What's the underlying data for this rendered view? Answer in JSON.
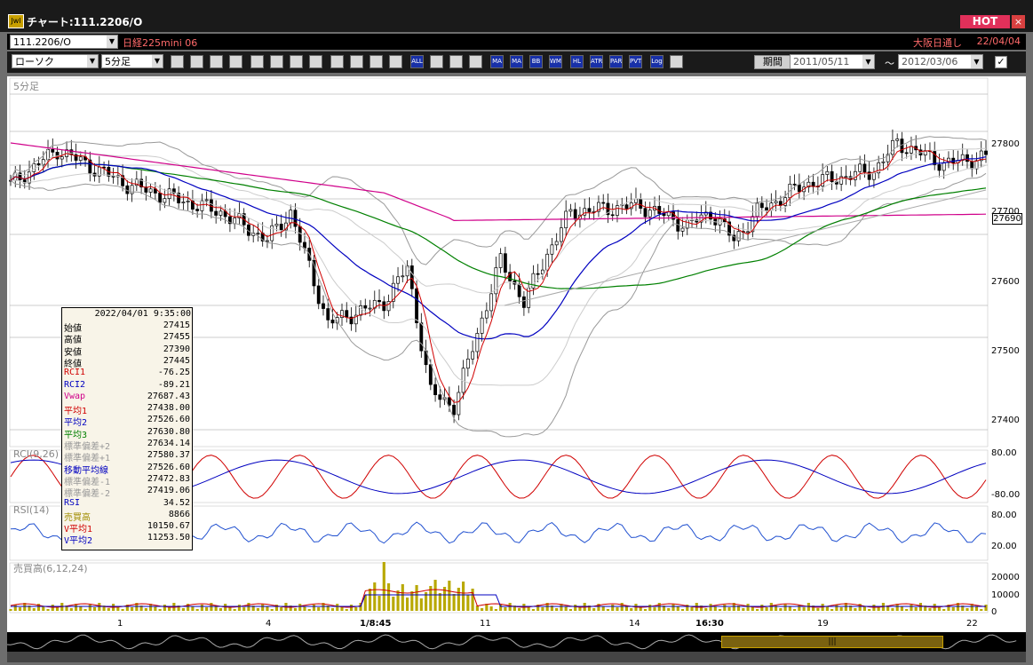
{
  "window": {
    "title": "チャート:111.2206/O",
    "hot": "HOT",
    "close": "×",
    "app_icon": "Jwl"
  },
  "toolbar1": {
    "symbol": "111.2206/O",
    "name": "日経225mini 06",
    "market": "大阪日通し",
    "date": "22/04/04"
  },
  "toolbar2": {
    "chart_type": "ローソク",
    "timeframe": "5分足",
    "tools": [
      "magnifier-icon",
      "crosshair-icon",
      "zoom-icon",
      "search-icon",
      "grid-icon",
      "candle-icon",
      "alert-icon",
      "pen-icon",
      "cursor-icon",
      "undo-icon",
      "box-icon",
      "box2-icon",
      "ALL",
      "fibo-icon",
      "brush-icon",
      "color-icon",
      "MA",
      "MA",
      "BB",
      "WMA",
      "HL",
      "ATR",
      "PARA",
      "PVT",
      "Log",
      "window-icon"
    ],
    "period_label": "期間",
    "date_from": "2011/05/11",
    "tilde": "～",
    "date_to": "2012/03/06",
    "check": "✓"
  },
  "panels": {
    "price": "5分足",
    "rci": "RCI(9,26)",
    "rsi": "RSI(14)",
    "volume": "売買高(6,12,24)"
  },
  "price_axis": [
    "27800",
    "27700",
    "27600",
    "27500",
    "27400"
  ],
  "current_price": "27690",
  "rci_axis": [
    "80.00",
    "-80.00"
  ],
  "rsi_axis": [
    "80.00",
    "20.00"
  ],
  "vol_axis": [
    "20000",
    "10000",
    "0"
  ],
  "x_axis": [
    {
      "label": "1",
      "pos": 132,
      "bold": false
    },
    {
      "label": "4",
      "pos": 299,
      "bold": false
    },
    {
      "label": "1/8:45",
      "pos": 405,
      "bold": true
    },
    {
      "label": "11",
      "pos": 540,
      "bold": false
    },
    {
      "label": "14",
      "pos": 708,
      "bold": false
    },
    {
      "label": "16:30",
      "pos": 783,
      "bold": true
    },
    {
      "label": "19",
      "pos": 920,
      "bold": false
    },
    {
      "label": "22",
      "pos": 1088,
      "bold": false
    }
  ],
  "databox": {
    "datetime": "2022/04/01 9:35:00",
    "rows": [
      {
        "k": "始値",
        "v": "27415",
        "c": "#000000"
      },
      {
        "k": "高値",
        "v": "27455",
        "c": "#000000"
      },
      {
        "k": "安値",
        "v": "27390",
        "c": "#000000"
      },
      {
        "k": "終値",
        "v": "27445",
        "c": "#000000"
      },
      {
        "k": "RCI1",
        "v": "-76.25",
        "c": "#d00000"
      },
      {
        "k": "RCI2",
        "v": "-89.21",
        "c": "#0000c0"
      },
      {
        "k": "Vwap",
        "v": "27687.43",
        "c": "#d0008a"
      },
      {
        "k": "平均1",
        "v": "27438.00",
        "c": "#d00000"
      },
      {
        "k": "平均2",
        "v": "27526.60",
        "c": "#0000c0"
      },
      {
        "k": "平均3",
        "v": "27630.80",
        "c": "#008000"
      },
      {
        "k": "標準偏差+2",
        "v": "27634.14",
        "c": "#999999"
      },
      {
        "k": "標準偏差+1",
        "v": "27580.37",
        "c": "#999999"
      },
      {
        "k": "移動平均線",
        "v": "27526.60",
        "c": "#0000c0"
      },
      {
        "k": "標準偏差-1",
        "v": "27472.83",
        "c": "#999999"
      },
      {
        "k": "標準偏差-2",
        "v": "27419.06",
        "c": "#999999"
      },
      {
        "k": "RSI",
        "v": "34.52",
        "c": "#0000c0"
      },
      {
        "k": "売買高",
        "v": "8866",
        "c": "#a08c00"
      },
      {
        "k": "V平均1",
        "v": "10150.67",
        "c": "#d00000"
      },
      {
        "k": "V平均2",
        "v": "11253.50",
        "c": "#0000c0"
      }
    ]
  },
  "colors": {
    "candle": "#000000",
    "ma1": "#d00000",
    "ma2": "#0000c0",
    "ma3": "#008000",
    "vwap": "#d0008a",
    "bb": "#999999",
    "volume": "#b8a800"
  }
}
